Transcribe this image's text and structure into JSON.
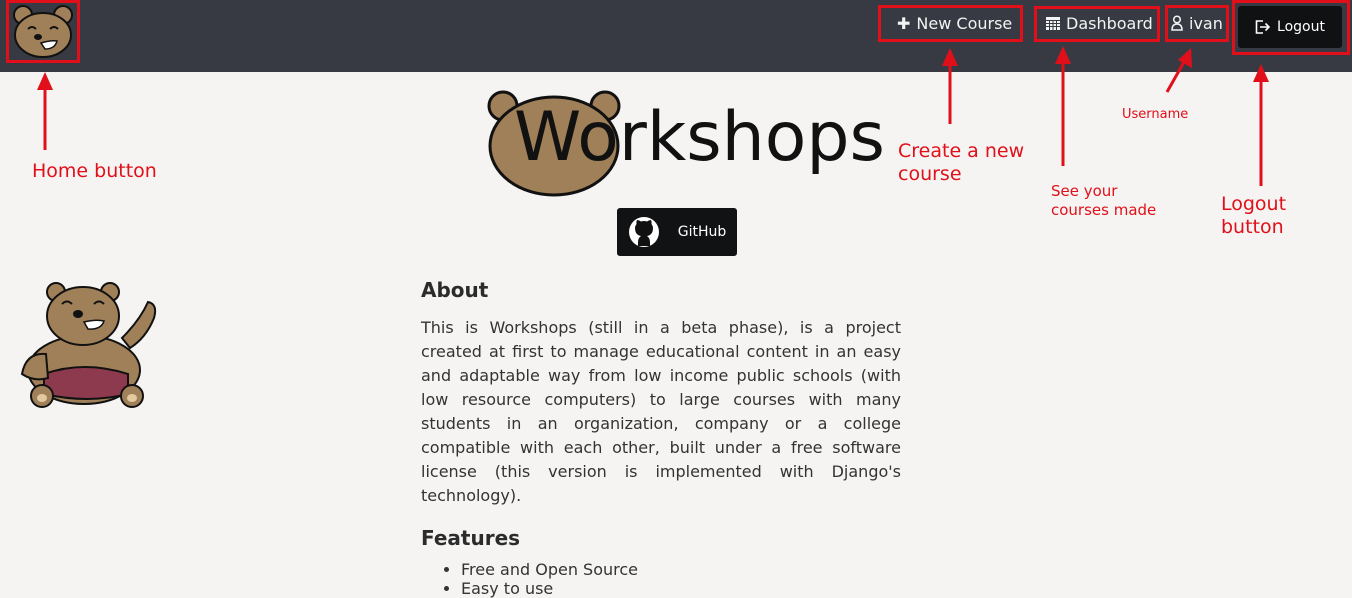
{
  "navbar": {
    "logo_icon": "bear-face-icon",
    "items": [
      {
        "label": "New Course",
        "icon": "plus-icon"
      },
      {
        "label": "Dashboard",
        "icon": "table-icon"
      },
      {
        "label": "ivan",
        "icon": "user-icon"
      }
    ],
    "logout": {
      "label": "Logout",
      "icon": "logout-icon"
    }
  },
  "hero": {
    "title": "Workshops",
    "github_label": "GitHub"
  },
  "about": {
    "heading": "About",
    "text": "This is Workshops (still in a beta phase), is a project created at first to manage educational content in an easy and adaptable way from low income public schools (with low resource computers) to large courses with many students in an organization, company or a college compatible with each other, built under a free software license (this version is implemented with Django's technology)."
  },
  "features": {
    "heading": "Features",
    "items": [
      "Free and Open Source",
      "Easy to use"
    ]
  },
  "annotations": {
    "home": "Home button",
    "new_course_line1": "Create a new",
    "new_course_line2": "course",
    "dashboard_line1": "See your",
    "dashboard_line2": "courses made",
    "username": "Username",
    "logout_line1": "Logout",
    "logout_line2": "button"
  },
  "colors": {
    "navbar": "#373a42",
    "annotation": "#e10f19",
    "background": "#f5f4f2",
    "bear_fur": "#a08058",
    "bear_pants": "#8e3a4e"
  }
}
